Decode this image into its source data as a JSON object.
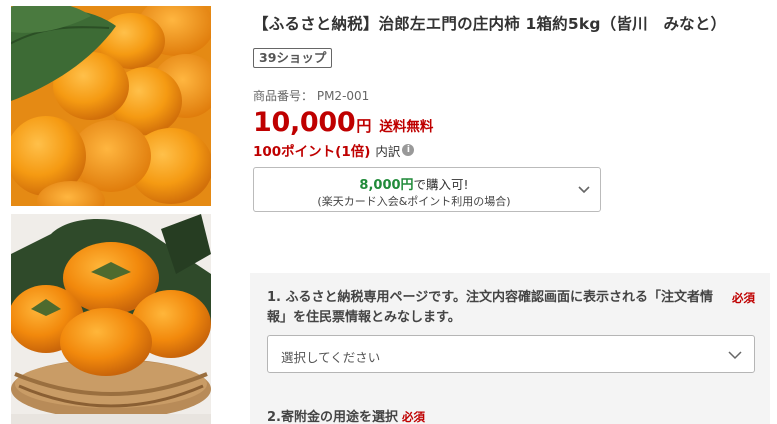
{
  "product": {
    "title": "【ふるさと納税】治郎左エ門の庄内柿 1箱約5kg（皆川　みなと）",
    "shop_badge": "39ショップ",
    "code_label": "商品番号：",
    "code_value": "PM2-001",
    "price_value": "10,000",
    "price_unit": "円",
    "shipping": "送料無料",
    "points": "100ポイント(1倍)",
    "points_detail": "内訳"
  },
  "card_offer": {
    "amount": "8,000円",
    "amount_suffix": "で購入可!",
    "note": "(楽天カード入会&ポイント利用の場合)"
  },
  "options": {
    "q1_label": "1. ふるさと納税専用ページです。注文内容確認画面に表示される「注文者情報」を住民票情報とみなします。",
    "q1_required": "必須",
    "q1_placeholder": "選択してください",
    "q2_label": "2.寄附金の用途を選択",
    "q2_required": "必須"
  },
  "colors": {
    "price_red": "#bf0000",
    "offer_green": "#218b3a",
    "panel_bg": "#f4f4f4"
  },
  "icons": {
    "info": "info-circle-icon",
    "chevron": "chevron-down-icon"
  }
}
